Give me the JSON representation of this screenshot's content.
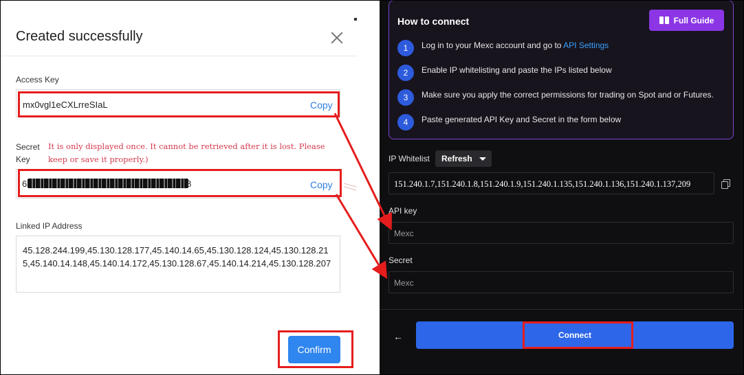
{
  "modal": {
    "title": "Created successfully",
    "access_key_label": "Access Key",
    "access_key_value": "mx0vgl1eCXLrreSIaL",
    "copy_label": "Copy",
    "secret_key_label_line1": "Secret",
    "secret_key_label_line2": "Key",
    "secret_warning": "It is only displayed once. It cannot be retrieved after it is lost. Please keep or save it properly.)",
    "secret_key_start": "6",
    "secret_key_end": "8",
    "linked_ip_label": "Linked IP Address",
    "linked_ip_value": "45.128.244.199,45.130.128.177,45.140.14.65,45.130.128.124,45.130.128.215,45.140.14.148,45.140.14.172,45.130.128.67,45.140.14.214,45.130.128.207",
    "confirm_label": "Confirm"
  },
  "connect_panel": {
    "title": "How to connect",
    "full_guide_label": "Full Guide",
    "steps": [
      {
        "num": "1",
        "text": "Log in to your Mexc account and go to ",
        "link": "API Settings"
      },
      {
        "num": "2",
        "text": "Enable IP whitelisting and paste the IPs listed below",
        "link": ""
      },
      {
        "num": "3",
        "text": "Make sure you apply the correct permissions for trading on Spot and or Futures.",
        "link": ""
      },
      {
        "num": "4",
        "text": "Paste generated API Key and Secret in the form below",
        "link": ""
      }
    ],
    "ip_whitelist_label": "IP Whitelist",
    "refresh_label": "Refresh",
    "ip_whitelist_value": "151.240.1.7,151.240.1.8,151.240.1.9,151.240.1.135,151.240.1.136,151.240.1.137,209",
    "api_key_label": "API key",
    "api_key_placeholder": "Mexc",
    "secret_label": "Secret",
    "secret_placeholder": "Mexc",
    "back_icon": "←",
    "connect_label": "Connect"
  },
  "colors": {
    "annotation_red": "#e51d1d",
    "confirm_blue": "#2f86ee",
    "connect_blue": "#2d66e8",
    "guide_purple": "#8b35e5",
    "warning_red": "#d43a4d"
  }
}
